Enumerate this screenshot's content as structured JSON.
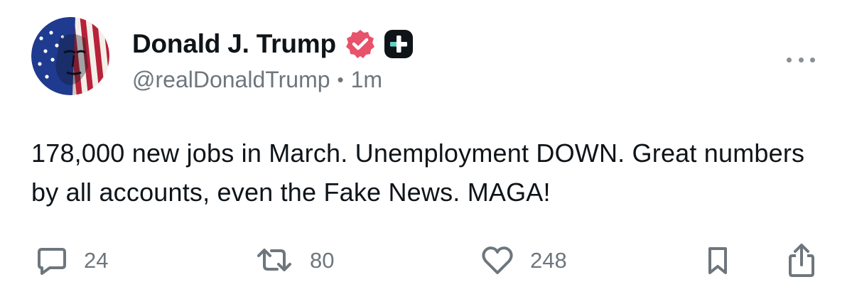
{
  "post": {
    "author": {
      "display_name": "Donald J. Trump",
      "handle": "@realDonaldTrump",
      "time_separator": "•",
      "time_ago": "1m",
      "verified_badge_color": "#e8526a",
      "avatar_icon": "flag-portrait-avatar"
    },
    "text": "178,000 new jobs in March. Unemployment DOWN. Great numbers by all accounts, even the Fake News. MAGA!",
    "actions": {
      "replies": "24",
      "reposts": "80",
      "likes": "248"
    },
    "icons": {
      "reply": "speech-bubble-icon",
      "repost": "repost-arrows-icon",
      "like": "heart-icon",
      "bookmark": "bookmark-icon",
      "share": "share-icon",
      "more": "ellipsis-icon",
      "plus": "plus-badge-icon",
      "verified": "verified-check-icon"
    },
    "colors": {
      "text": "#0f1419",
      "secondary": "#6e767d",
      "icon": "#6e767d"
    }
  }
}
